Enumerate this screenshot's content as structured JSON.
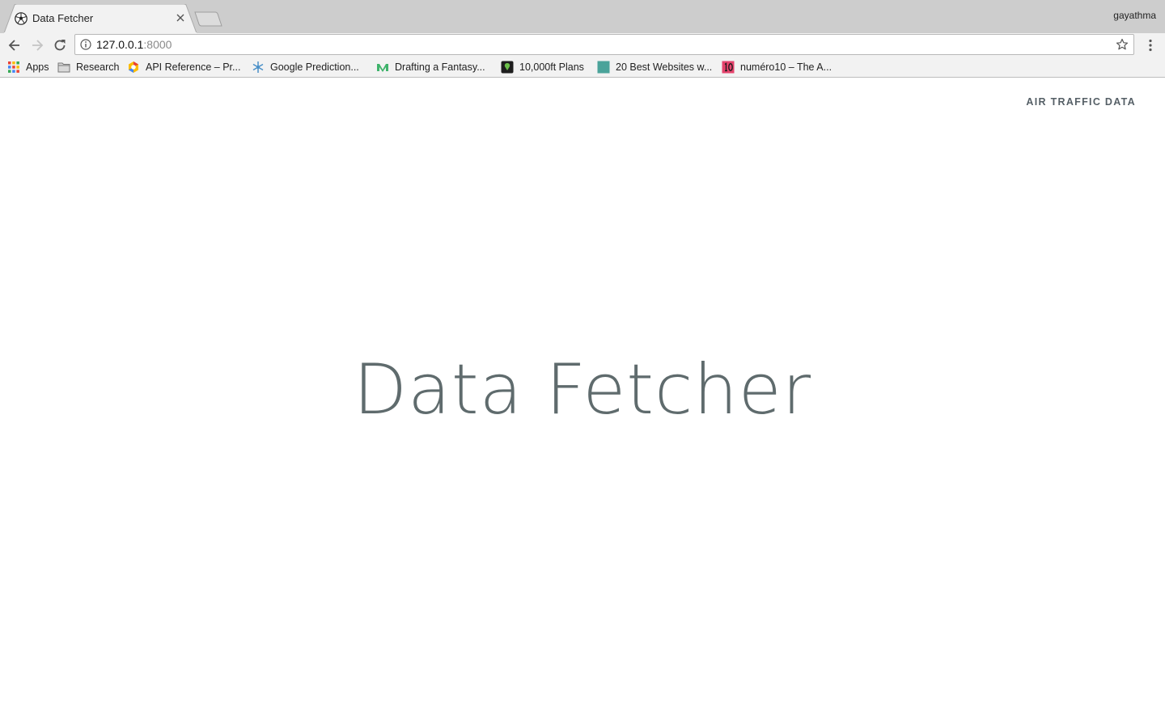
{
  "browser": {
    "tab": {
      "title": "Data Fetcher",
      "favicon": "soccer-ball-icon"
    },
    "profile_name": "gayathma",
    "omnibox": {
      "url_host": "127.0.0.1",
      "url_port": ":8000"
    },
    "bookmarks": [
      {
        "label": "Apps",
        "icon": "apps-grid-icon"
      },
      {
        "label": "Research",
        "icon": "folder-icon"
      },
      {
        "label": "API Reference – Pr...",
        "icon": "google-cloud-icon"
      },
      {
        "label": "Google Prediction...",
        "icon": "snowflake-icon"
      },
      {
        "label": "Drafting a Fantasy...",
        "icon": "medium-icon"
      },
      {
        "label": "10,000ft Plans",
        "icon": "10000ft-icon"
      },
      {
        "label": "20 Best Websites w...",
        "icon": "teal-square-icon"
      },
      {
        "label": "numéro10 – The A...",
        "icon": "numero10-icon"
      }
    ]
  },
  "page": {
    "nav_link": "AIR TRAFFIC DATA",
    "hero_title": "Data Fetcher"
  },
  "colors": {
    "tabstrip": "#cdcdcd",
    "toolbar": "#f2f2f2",
    "hero_text": "#5f6b6d",
    "nav_link": "#555f66"
  }
}
